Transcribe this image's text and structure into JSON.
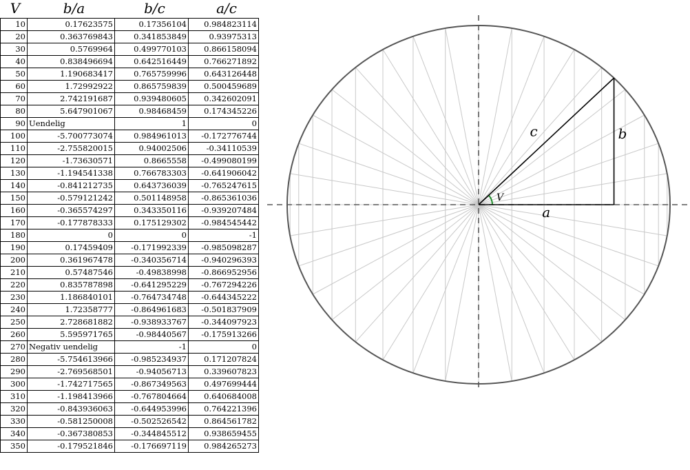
{
  "table": {
    "headers": {
      "v": "V",
      "b_over_a": "b/a",
      "b_over_c": "b/c",
      "a_over_c": "a/c"
    },
    "rows": [
      [
        "10",
        "0.17623575",
        "0.17356104",
        "0.984823114"
      ],
      [
        "20",
        "0.363769843",
        "0.341853849",
        "0.93975313"
      ],
      [
        "30",
        "0.5769964",
        "0.499770103",
        "0.866158094"
      ],
      [
        "40",
        "0.838496694",
        "0.642516449",
        "0.766271892"
      ],
      [
        "50",
        "1.190683417",
        "0.765759996",
        "0.643126448"
      ],
      [
        "60",
        "1.72992922",
        "0.865759839",
        "0.500459689"
      ],
      [
        "70",
        "2.742191687",
        "0.939480605",
        "0.342602091"
      ],
      [
        "80",
        "5.647901067",
        "0.98468459",
        "0.174345226"
      ],
      [
        "90",
        "Uendelig",
        "1",
        "0"
      ],
      [
        "100",
        "-5.700773074",
        "0.984961013",
        "-0.172776744"
      ],
      [
        "110",
        "-2.755820015",
        "0.94002506",
        "-0.34110539"
      ],
      [
        "120",
        "-1.73630571",
        "0.8665558",
        "-0.499080199"
      ],
      [
        "130",
        "-1.194541338",
        "0.766783303",
        "-0.641906042"
      ],
      [
        "140",
        "-0.841212735",
        "0.643736039",
        "-0.765247615"
      ],
      [
        "150",
        "-0.579121242",
        "0.501148958",
        "-0.865361036"
      ],
      [
        "160",
        "-0.365574297",
        "0.343350116",
        "-0.939207484"
      ],
      [
        "170",
        "-0.177878333",
        "0.175129302",
        "-0.984545442"
      ],
      [
        "180",
        "0",
        "0",
        "-1"
      ],
      [
        "190",
        "0.17459409",
        "-0.171992339",
        "-0.985098287"
      ],
      [
        "200",
        "0.361967478",
        "-0.340356714",
        "-0.940296393"
      ],
      [
        "210",
        "0.57487546",
        "-0.49838998",
        "-0.866952956"
      ],
      [
        "220",
        "0.835787898",
        "-0.641295229",
        "-0.767294226"
      ],
      [
        "230",
        "1.186840101",
        "-0.764734748",
        "-0.644345222"
      ],
      [
        "240",
        "1.72358777",
        "-0.864961683",
        "-0.501837909"
      ],
      [
        "250",
        "2.728681882",
        "-0.938933767",
        "-0.344097923"
      ],
      [
        "260",
        "5.595971765",
        "-0.98440567",
        "-0.175913266"
      ],
      [
        "270",
        "Negativ uendelig",
        "-1",
        "0"
      ],
      [
        "280",
        "-5.754613966",
        "-0.985234937",
        "0.171207824"
      ],
      [
        "290",
        "-2.769568501",
        "-0.94056713",
        "0.339607823"
      ],
      [
        "300",
        "-1.742717565",
        "-0.867349563",
        "0.497699444"
      ],
      [
        "310",
        "-1.198413966",
        "-0.767804664",
        "0.640684008"
      ],
      [
        "320",
        "-0.843936063",
        "-0.644953996",
        "0.764221396"
      ],
      [
        "330",
        "-0.581250008",
        "-0.502526542",
        "0.864561782"
      ],
      [
        "340",
        "-0.367380853",
        "-0.344845512",
        "0.938659455"
      ],
      [
        "350",
        "-0.179521846",
        "-0.176697119",
        "0.984265273"
      ]
    ]
  },
  "diagram": {
    "labels": {
      "a": "a",
      "b": "b",
      "c": "c",
      "angle": "V"
    },
    "ray_step_degrees": 10,
    "triangle_angle_degrees": 45,
    "colors": {
      "circle": "#555555",
      "rays": "#c8c8c8",
      "axes": "#555555",
      "triangle": "#000000",
      "angle_arc": "#1e8c2a"
    }
  }
}
